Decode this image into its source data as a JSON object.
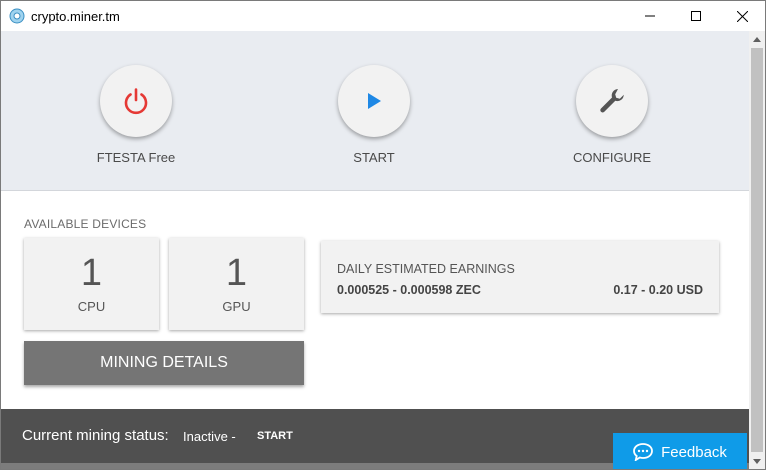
{
  "window": {
    "title": "crypto.miner.tm",
    "controls": [
      "minimize",
      "maximize",
      "close"
    ]
  },
  "actions": {
    "power": {
      "label": "FTESTA Free",
      "icon": "power-icon",
      "icon_color": "#e53935"
    },
    "start": {
      "label": "START",
      "icon": "play-icon",
      "icon_color": "#1e88e5"
    },
    "configure": {
      "label": "CONFIGURE",
      "icon": "wrench-icon",
      "icon_color": "#555555"
    }
  },
  "devices": {
    "title": "AVAILABLE DEVICES",
    "cpu": {
      "count": "1",
      "label": "CPU"
    },
    "gpu": {
      "count": "1",
      "label": "GPU"
    }
  },
  "mining_details_label": "MINING DETAILS",
  "earnings": {
    "title": "DAILY ESTIMATED EARNINGS",
    "zec": "0.000525 - 0.000598 ZEC",
    "usd": "0.17 - 0.20 USD"
  },
  "status": {
    "label": "Current mining status:",
    "value": "Inactive -",
    "start_link": "START"
  },
  "feedback": {
    "label": "Feedback",
    "icon": "chat-icon"
  },
  "colors": {
    "accent": "#0f9be8",
    "status_bar": "#505050",
    "top_panel": "#e9ecf1",
    "mining_button": "#757575"
  }
}
